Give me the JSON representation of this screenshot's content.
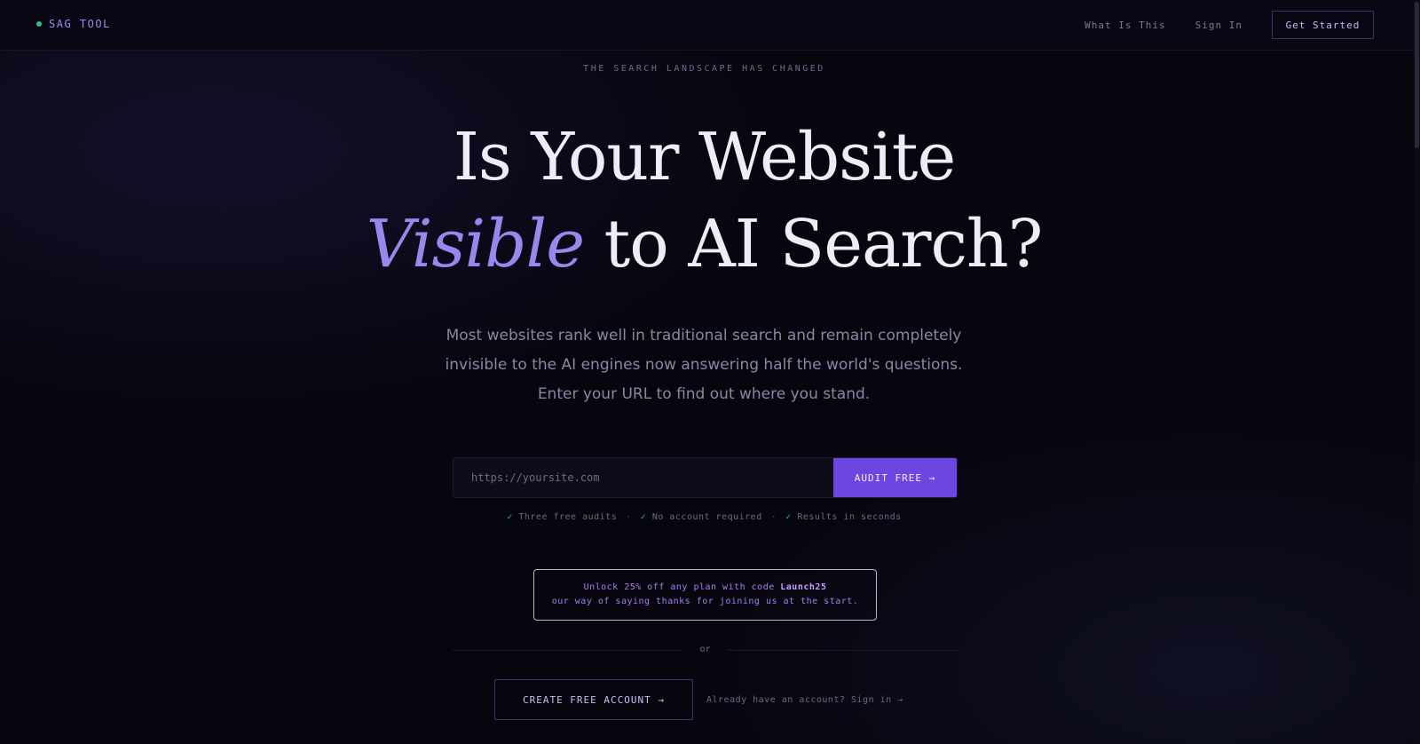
{
  "nav": {
    "brand": "SAG TOOL",
    "links": [
      "What Is This",
      "Sign In"
    ],
    "cta": "Get Started"
  },
  "hero": {
    "eyebrow": "THE SEARCH LANDSCAPE HAS CHANGED",
    "headline_line1": "Is Your Website",
    "headline_accent": "Visible",
    "headline_line2_rest": " to AI Search?",
    "subtext": "Most websites rank well in traditional search and remain completely invisible to the AI engines now answering half the world's questions. Enter your URL to find out where you stand."
  },
  "audit": {
    "placeholder": "https://yoursite.com",
    "button": "AUDIT FREE →"
  },
  "perks": [
    "Three free audits",
    "No account required",
    "Results in seconds"
  ],
  "promo": {
    "line1_prefix": "Unlock 25% off any plan with code ",
    "code": "Launch25",
    "line2": "our way of saying thanks for joining us at the start."
  },
  "divider": "or",
  "create_account": "CREATE FREE ACCOUNT →",
  "signin_text": "Already have an account? Sign in →",
  "colors": {
    "background": "#07060f",
    "accent": "#6d45e0",
    "accent_text": "#9a86ec",
    "check": "#2fbf8a"
  },
  "icons": {
    "brand_dot": "status-dot-icon",
    "perk": "check-icon"
  }
}
